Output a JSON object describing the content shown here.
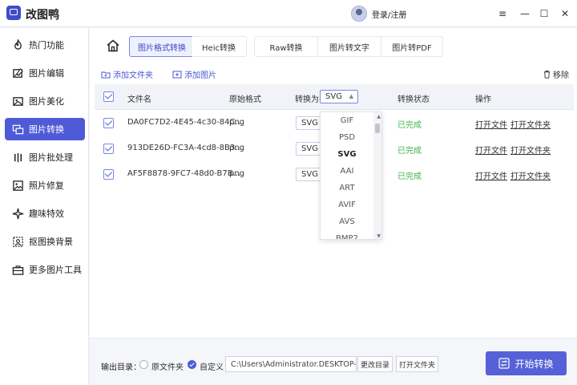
{
  "app": {
    "title": "改图鸭",
    "login_text": "登录/注册"
  },
  "window": {
    "menu": "≡",
    "minimize": "—",
    "maximize": "☐",
    "close": "✕"
  },
  "sidebar": {
    "items": [
      {
        "label": "热门功能",
        "icon": "fire-icon"
      },
      {
        "label": "图片编辑",
        "icon": "image-edit-icon"
      },
      {
        "label": "图片美化",
        "icon": "image-beautify-icon"
      },
      {
        "label": "图片转换",
        "icon": "image-convert-icon"
      },
      {
        "label": "图片批处理",
        "icon": "batch-icon"
      },
      {
        "label": "照片修复",
        "icon": "photo-repair-icon"
      },
      {
        "label": "趣味特效",
        "icon": "sparkle-icon"
      },
      {
        "label": "抠图换背景",
        "icon": "cutout-icon"
      },
      {
        "label": "更多图片工具",
        "icon": "toolbox-icon"
      }
    ],
    "active_index": 3
  },
  "tabs": [
    {
      "label": "图片格式转换"
    },
    {
      "label": "Heic转换"
    },
    {
      "label": "Raw转换"
    },
    {
      "label": "图片转文字"
    },
    {
      "label": "图片转PDF"
    }
  ],
  "toolbar": {
    "add_folder": "添加文件夹",
    "add_image": "添加图片",
    "remove": "移除"
  },
  "table": {
    "headers": {
      "filename": "文件名",
      "original_format": "原始格式",
      "convert_to": "转换为",
      "status": "转换状态",
      "actions": "操作"
    },
    "header_format": "SVG",
    "rows": [
      {
        "filename": "DA0FC7D2-4E45-4c30-84C...",
        "format": "png",
        "target": "SVG",
        "status": "已完成",
        "open_file": "打开文件",
        "open_folder": "打开文件夹"
      },
      {
        "filename": "913DE26D-FC3A-4cd8-8B3...",
        "format": "png",
        "target": "SVG",
        "status": "已完成",
        "open_file": "打开文件",
        "open_folder": "打开文件夹"
      },
      {
        "filename": "AF5F8878-9FC7-48d0-B7B...",
        "format": "png",
        "target": "SVG",
        "status": "已完成",
        "open_file": "打开文件",
        "open_folder": "打开文件夹"
      }
    ]
  },
  "dropdown": {
    "options": [
      "GIF",
      "PSD",
      "SVG",
      "AAI",
      "ART",
      "AVIF",
      "AVS",
      "BMP2"
    ],
    "selected": "SVG",
    "scroll_up": "▲",
    "scroll_down": "▼"
  },
  "footer": {
    "output_label": "输出目录：",
    "option_original": "原文件夹",
    "option_custom": "自定义",
    "path": "C:\\Users\\Administrator.DESKTOP-TD...",
    "change_dir": "更改目录",
    "open_folder": "打开文件夹",
    "start": "开始转换"
  },
  "colors": {
    "accent": "#5661d8",
    "success": "#3bb54a",
    "sidebar_active": "#4f5ad6"
  }
}
